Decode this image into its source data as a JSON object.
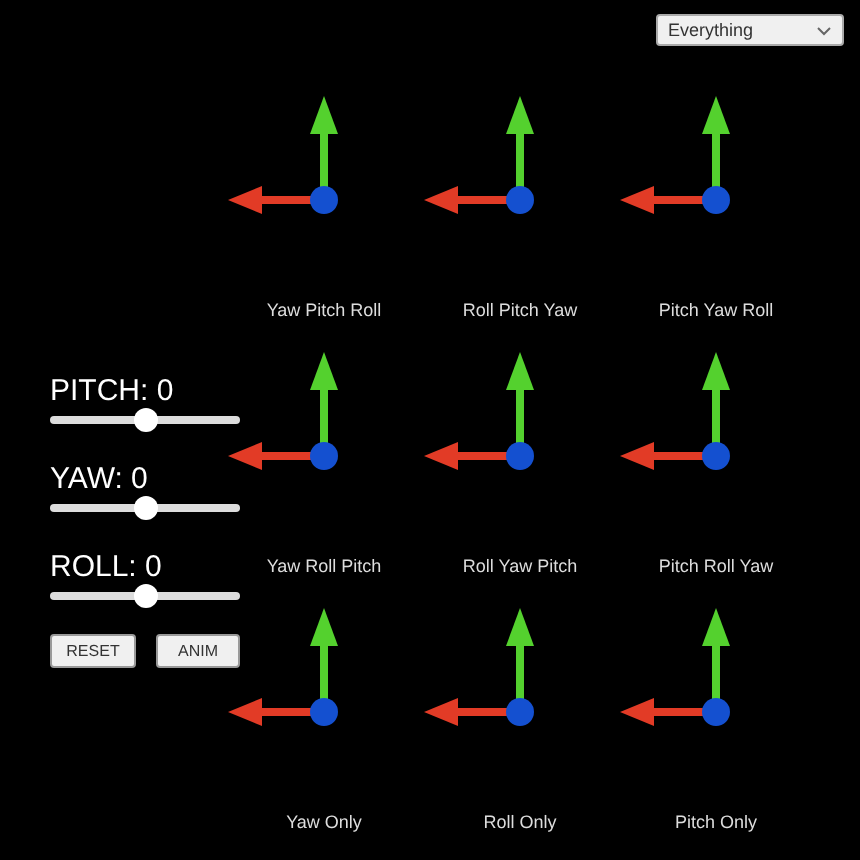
{
  "dropdown": {
    "value": "Everything"
  },
  "gizmos": [
    {
      "label": "Yaw Pitch Roll"
    },
    {
      "label": "Roll Pitch Yaw"
    },
    {
      "label": "Pitch Yaw Roll"
    },
    {
      "label": "Yaw Roll Pitch"
    },
    {
      "label": "Roll Yaw Pitch"
    },
    {
      "label": "Pitch Roll Yaw"
    },
    {
      "label": "Yaw Only"
    },
    {
      "label": "Roll Only"
    },
    {
      "label": "Pitch Only"
    }
  ],
  "sliders": [
    {
      "label": "PITCH: 0",
      "level": 0.5
    },
    {
      "label": "YAW: 0",
      "level": 0.5
    },
    {
      "label": "ROLL: 0",
      "level": 0.5
    }
  ],
  "buttons": [
    "RESET",
    "ANIM"
  ]
}
